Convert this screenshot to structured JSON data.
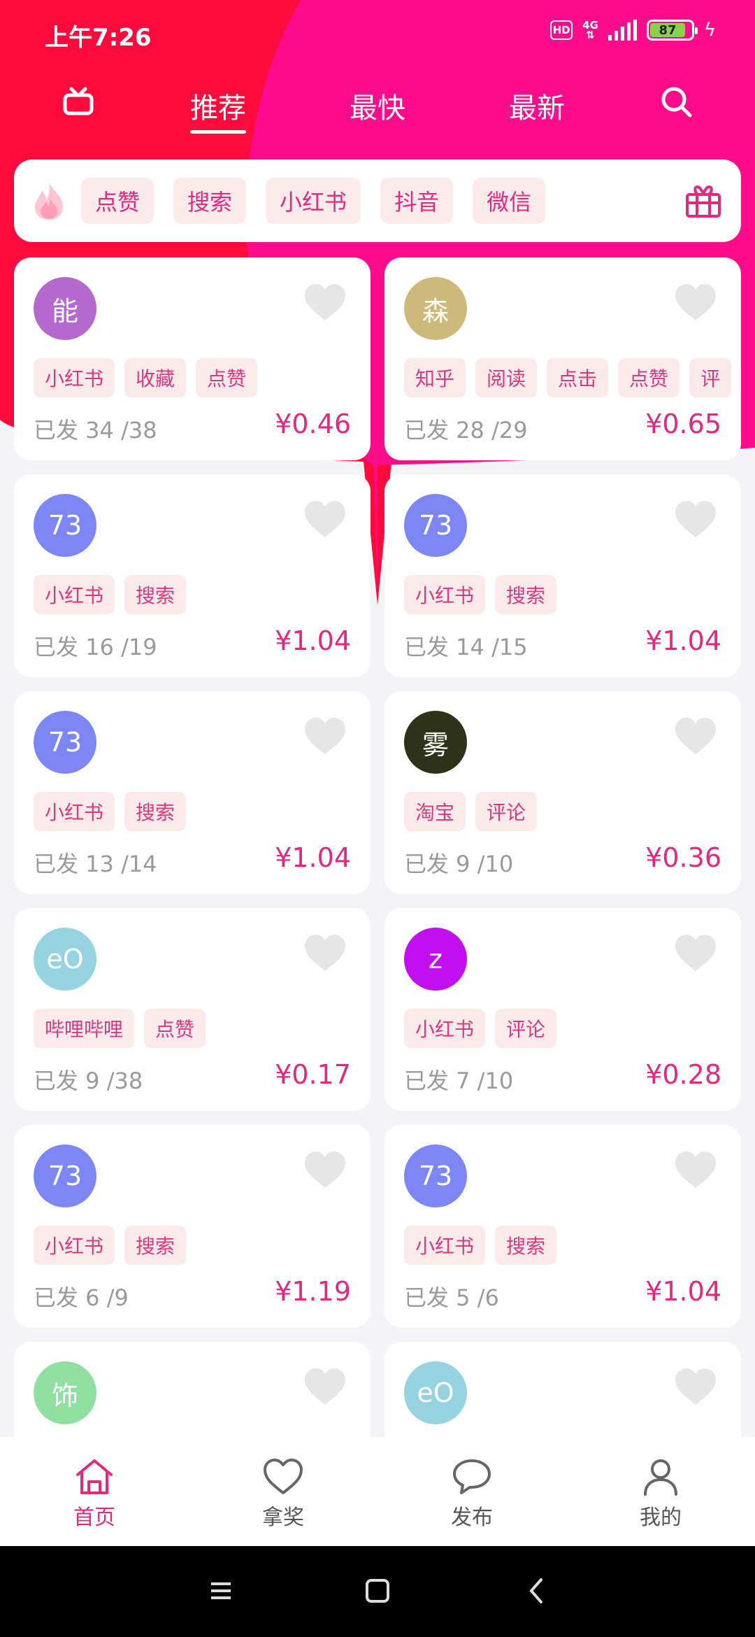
{
  "status": {
    "time": "上午7:26",
    "hd": "HD",
    "network": "4G",
    "battery": "87"
  },
  "top_nav": {
    "tabs": [
      {
        "label": "推荐",
        "active": true
      },
      {
        "label": "最快",
        "active": false
      },
      {
        "label": "最新",
        "active": false
      }
    ]
  },
  "chips": [
    "点赞",
    "搜索",
    "小红书",
    "抖音",
    "微信"
  ],
  "cards": [
    {
      "avatar": "能",
      "avatar_color": "#b569cf",
      "tags": [
        "小红书",
        "收藏",
        "点赞"
      ],
      "sent": "已发 34 /38",
      "price": "¥0.46"
    },
    {
      "avatar": "森",
      "avatar_color": "#cdb97a",
      "tags": [
        "知乎",
        "阅读",
        "点击",
        "点赞",
        "评"
      ],
      "sent": "已发 28 /29",
      "price": "¥0.65"
    },
    {
      "avatar": "73",
      "avatar_color": "#7d86f5",
      "tags": [
        "小红书",
        "搜索"
      ],
      "sent": "已发 16 /19",
      "price": "¥1.04"
    },
    {
      "avatar": "73",
      "avatar_color": "#7d86f5",
      "tags": [
        "小红书",
        "搜索"
      ],
      "sent": "已发 14 /15",
      "price": "¥1.04"
    },
    {
      "avatar": "73",
      "avatar_color": "#7d86f5",
      "tags": [
        "小红书",
        "搜索"
      ],
      "sent": "已发 13 /14",
      "price": "¥1.04"
    },
    {
      "avatar": "雾",
      "avatar_color": "#2e3218",
      "tags": [
        "淘宝",
        "评论"
      ],
      "sent": "已发 9 /10",
      "price": "¥0.36"
    },
    {
      "avatar": "eO",
      "avatar_color": "#95d3e0",
      "tags": [
        "哔哩哔哩",
        "点赞"
      ],
      "sent": "已发 9 /38",
      "price": "¥0.17"
    },
    {
      "avatar": "z",
      "avatar_color": "#c20ff0",
      "tags": [
        "小红书",
        "评论"
      ],
      "sent": "已发 7 /10",
      "price": "¥0.28"
    },
    {
      "avatar": "73",
      "avatar_color": "#7d86f5",
      "tags": [
        "小红书",
        "搜索"
      ],
      "sent": "已发 6 /9",
      "price": "¥1.19"
    },
    {
      "avatar": "73",
      "avatar_color": "#7d86f5",
      "tags": [
        "小红书",
        "搜索"
      ],
      "sent": "已发 5 /6",
      "price": "¥1.04"
    },
    {
      "avatar": "饰",
      "avatar_color": "#8fe0a0",
      "tags": [],
      "sent": "",
      "price": ""
    },
    {
      "avatar": "eO",
      "avatar_color": "#95d3e0",
      "tags": [],
      "sent": "",
      "price": ""
    }
  ],
  "bottom_nav": [
    {
      "label": "首页",
      "icon": "home-icon",
      "active": true
    },
    {
      "label": "拿奖",
      "icon": "heart-icon",
      "active": false
    },
    {
      "label": "发布",
      "icon": "chat-icon",
      "active": false
    },
    {
      "label": "我的",
      "icon": "user-icon",
      "active": false
    }
  ],
  "colors": {
    "accent": "#e0297f",
    "bg_red": "#ff0a3c",
    "bg_pink": "#ff0c8c"
  }
}
